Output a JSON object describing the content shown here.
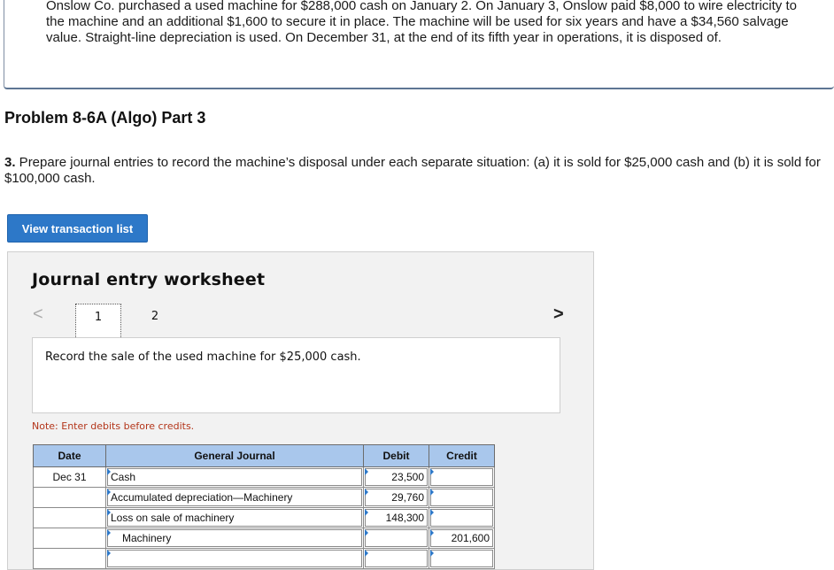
{
  "intro": {
    "text": "Onslow Co. purchased a used machine for $288,000 cash on January 2. On January 3, Onslow paid $8,000 to wire electricity to the machine and an additional $1,600 to secure it in place. The machine will be used for six years and have a $34,560 salvage value. Straight-line depreciation is used. On December 31, at the end of its fifth year in operations, it is disposed of."
  },
  "problem_title": "Problem 8-6A (Algo) Part 3",
  "question": {
    "number": "3.",
    "text": " Prepare journal entries to record the machine’s disposal under each separate situation: (a) it is sold for $25,000 cash and (b) it is sold for $100,000 cash."
  },
  "view_button": "View transaction list",
  "worksheet": {
    "title": "Journal entry worksheet",
    "prev_icon": "<",
    "next_icon": ">",
    "pages": [
      "1",
      "2"
    ],
    "prompt": "Record the sale of the used machine for $25,000 cash.",
    "note": "Note: Enter debits before credits.",
    "table": {
      "headers": {
        "date": "Date",
        "journal": "General Journal",
        "debit": "Debit",
        "credit": "Credit"
      },
      "rows": [
        {
          "date": "Dec 31",
          "account": "Cash",
          "debit": "23,500",
          "credit": ""
        },
        {
          "date": "",
          "account": "Accumulated depreciation—Machinery",
          "debit": "29,760",
          "credit": ""
        },
        {
          "date": "",
          "account": "Loss on sale of machinery",
          "debit": "148,300",
          "credit": ""
        },
        {
          "date": "",
          "account": "Machinery",
          "debit": "",
          "credit": "201,600"
        },
        {
          "date": "",
          "account": "",
          "debit": "",
          "credit": ""
        }
      ]
    }
  }
}
